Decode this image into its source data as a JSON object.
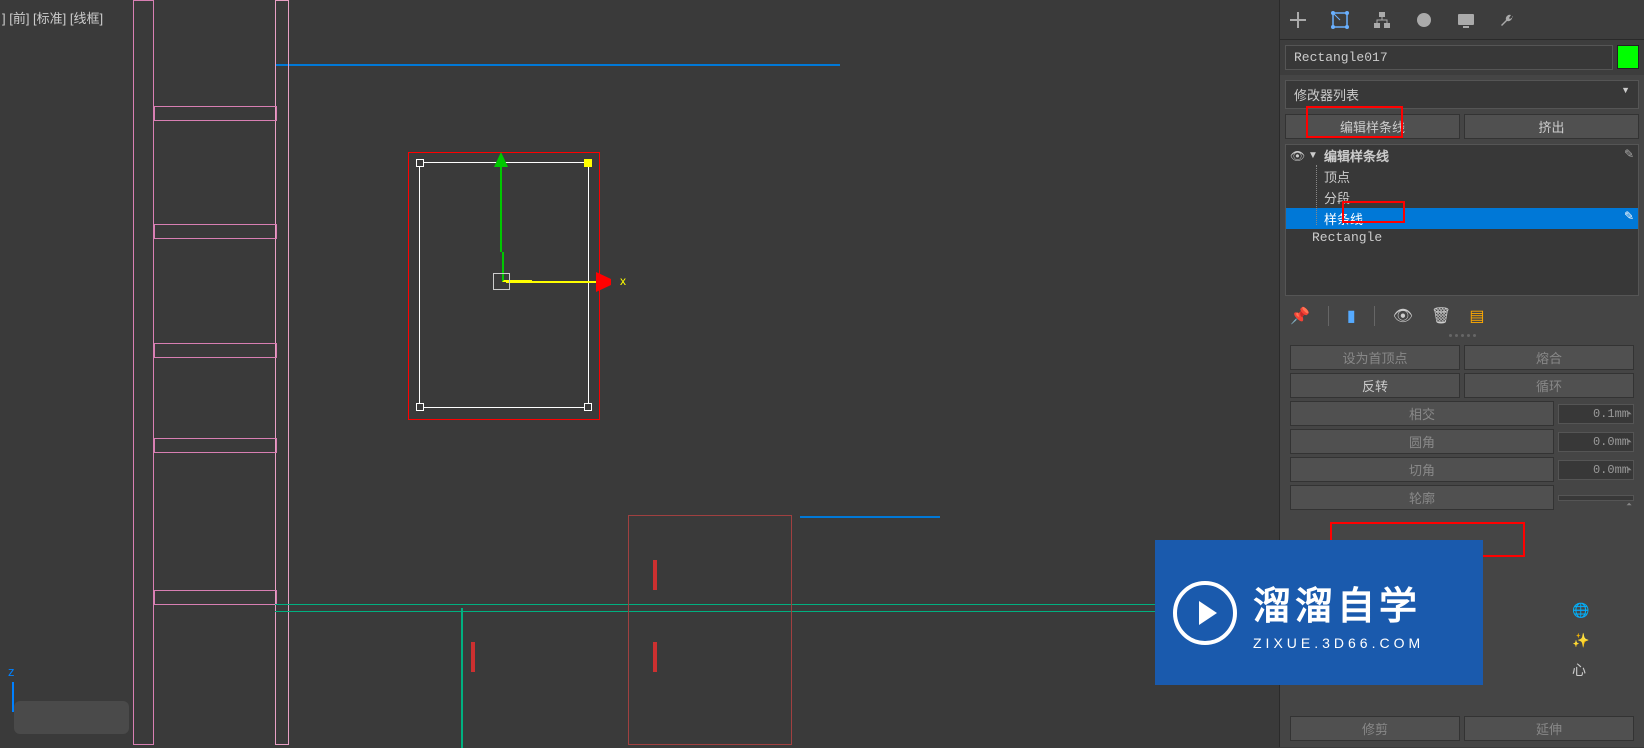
{
  "viewport": {
    "label": "] [前] [标准] [线框]"
  },
  "gizmo": {
    "x_label": "x"
  },
  "axis": {
    "z_label": "z"
  },
  "panel": {
    "object_name": "Rectangle017",
    "modifier_list": "修改器列表",
    "buttons": {
      "edit_spline": "编辑样条线",
      "extrude": "挤出"
    },
    "stack": {
      "modifier": "编辑样条线",
      "sub1": "顶点",
      "sub2": "分段",
      "sub3": "样条线",
      "base": "Rectangle"
    },
    "ops": {
      "first_vertex": "设为首顶点",
      "weld": "熔合",
      "reverse": "反转",
      "cycle": "循环",
      "intersect": "相交",
      "v1": "0.1mm",
      "fillet": "圆角",
      "v2": "0.0mm",
      "chamfer": "切角",
      "v3": "0.0mm",
      "outline": "轮廓",
      "v4": "",
      "trim": "修剪",
      "extend": "延伸",
      "center_label": "心"
    }
  },
  "watermark": {
    "title": "溜溜自学",
    "subtitle": "ZIXUE.3D66.COM"
  }
}
